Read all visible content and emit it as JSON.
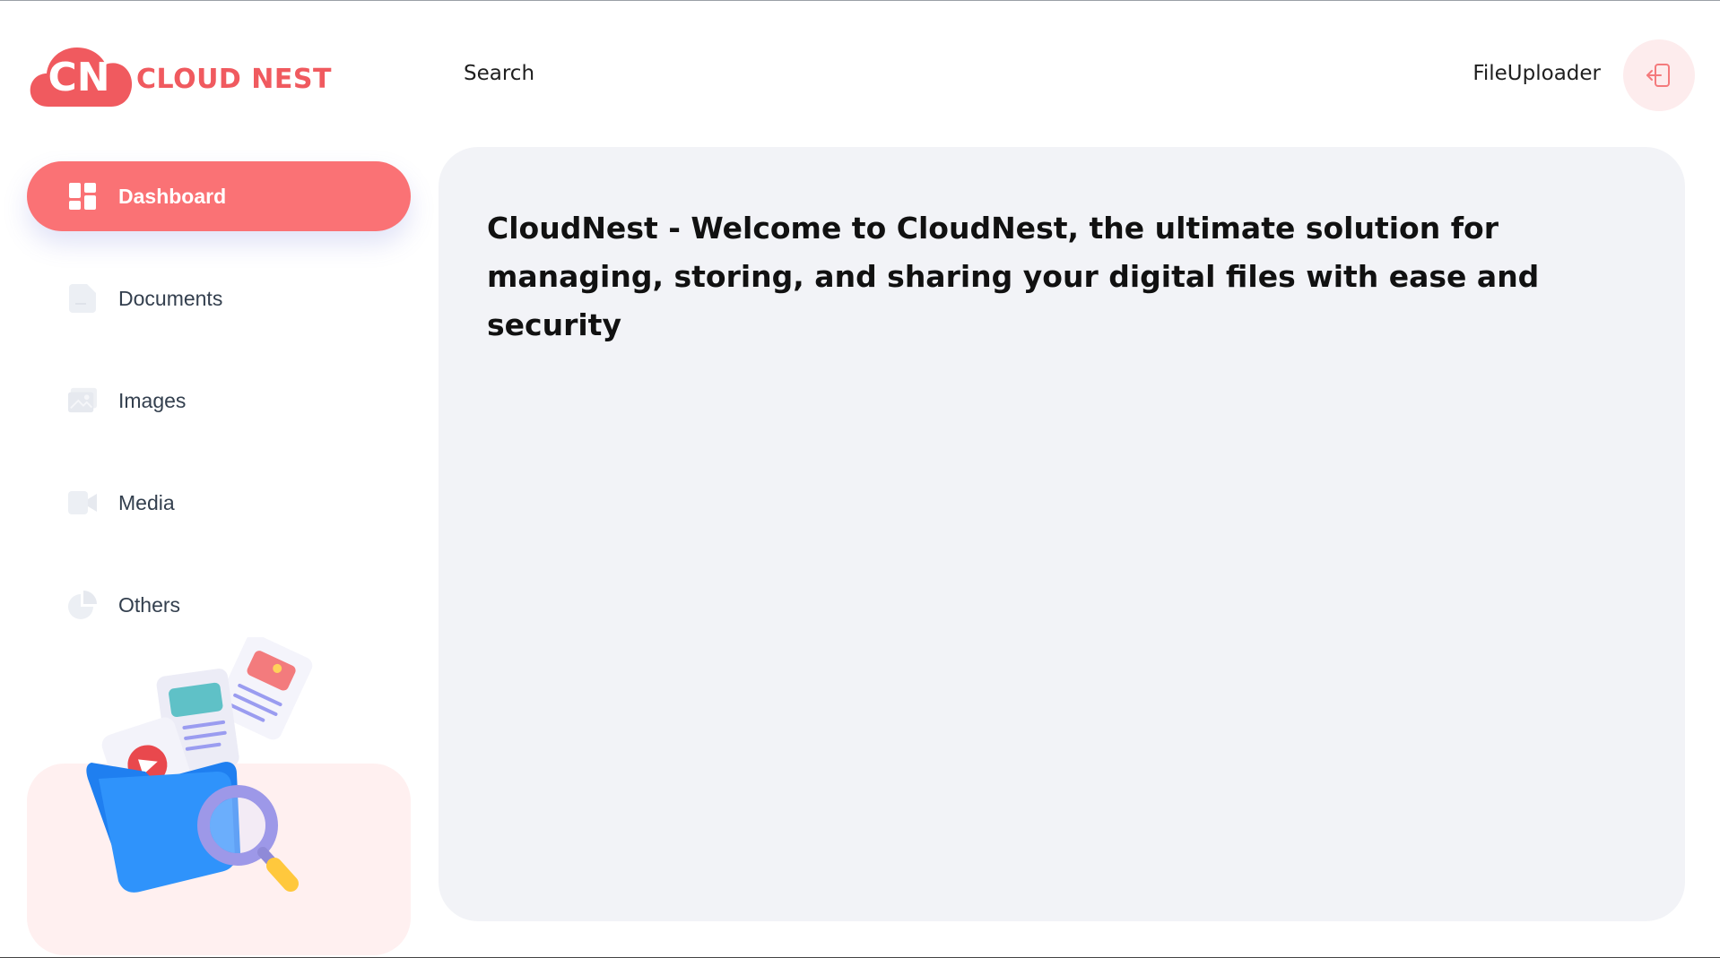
{
  "brand": {
    "monogram": "CN",
    "name": "CLOUD NEST",
    "color": "#f05a5f"
  },
  "header": {
    "search_label": "Search",
    "user_name": "FileUploader",
    "logout_icon": "logout-icon"
  },
  "sidebar": {
    "items": [
      {
        "label": "Dashboard",
        "icon": "dashboard-icon",
        "active": true
      },
      {
        "label": "Documents",
        "icon": "document-icon",
        "active": false
      },
      {
        "label": "Images",
        "icon": "image-icon",
        "active": false
      },
      {
        "label": "Media",
        "icon": "video-icon",
        "active": false
      },
      {
        "label": "Others",
        "icon": "pie-chart-icon",
        "active": false
      }
    ],
    "illustration": "folder-search-illustration"
  },
  "main": {
    "heading": "CloudNest - Welcome to CloudNest, the ultimate solution for managing, storing, and sharing your digital files with ease and security"
  },
  "colors": {
    "accent": "#fa7275",
    "panel_bg": "#f2f3f7",
    "promo_bg": "#fff0f0"
  }
}
